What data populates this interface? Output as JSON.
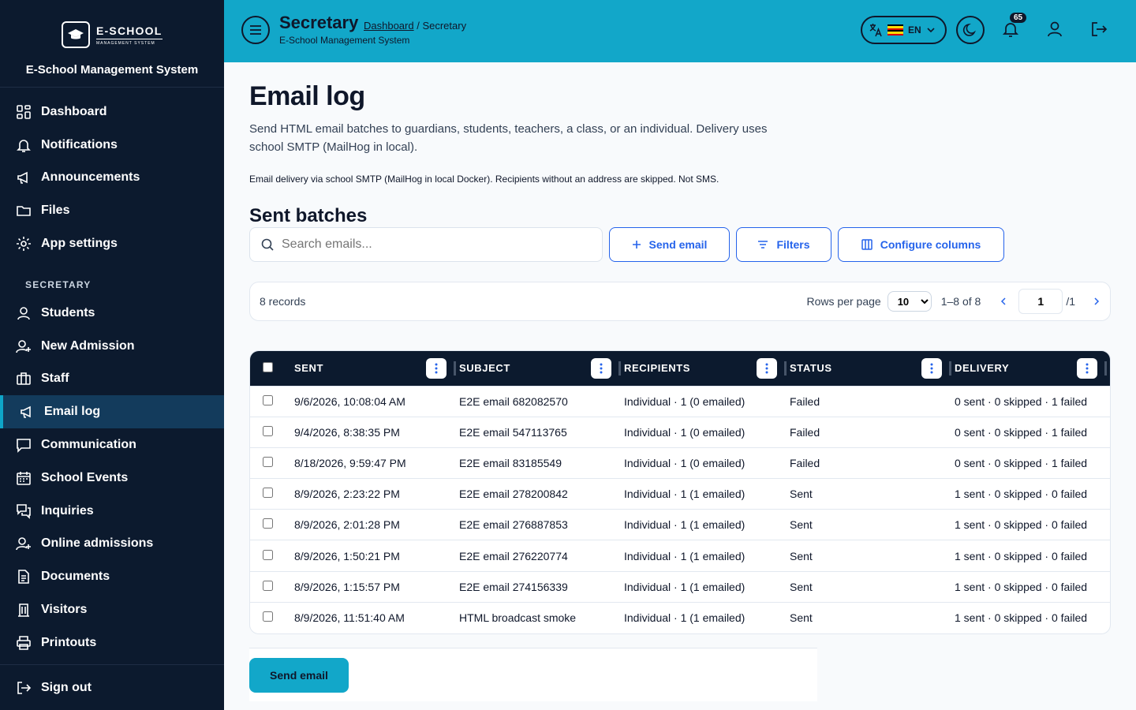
{
  "app": {
    "logo_title": "E-SCHOOL",
    "logo_sub": "MANAGEMENT SYSTEM",
    "name": "E-School Management System"
  },
  "sidebar": {
    "items_top": [
      {
        "label": "Dashboard",
        "icon": "dashboard-icon"
      },
      {
        "label": "Notifications",
        "icon": "bell-icon"
      },
      {
        "label": "Announcements",
        "icon": "megaphone-icon"
      },
      {
        "label": "Files",
        "icon": "folder-icon"
      },
      {
        "label": "App settings",
        "icon": "gear-icon"
      }
    ],
    "section_label": "SECRETARY",
    "items_section": [
      {
        "label": "Students",
        "icon": "user-icon"
      },
      {
        "label": "New Admission",
        "icon": "user-plus-icon"
      },
      {
        "label": "Staff",
        "icon": "briefcase-icon"
      },
      {
        "label": "Email log",
        "icon": "megaphone-icon",
        "active": true
      },
      {
        "label": "Communication",
        "icon": "chat-icon"
      },
      {
        "label": "School Events",
        "icon": "calendar-icon"
      },
      {
        "label": "Inquiries",
        "icon": "chats-icon"
      },
      {
        "label": "Online admissions",
        "icon": "user-plus-icon"
      },
      {
        "label": "Documents",
        "icon": "document-icon"
      },
      {
        "label": "Visitors",
        "icon": "building-icon"
      },
      {
        "label": "Printouts",
        "icon": "printer-icon"
      }
    ],
    "sign_out": "Sign out"
  },
  "header": {
    "title": "Secretary",
    "crumb_link": "Dashboard",
    "crumb_current": " / Secretary",
    "subtitle": "E-School Management System",
    "lang": "EN",
    "notif_count": "65"
  },
  "page": {
    "title": "Email log",
    "description": "Send HTML email batches to guardians, students, teachers, a class, or an individual. Delivery uses school SMTP (MailHog in local).",
    "note": "Email delivery via school SMTP (MailHog in local Docker). Recipients without an address are skipped. Not SMS.",
    "section_title": "Sent batches"
  },
  "toolbar": {
    "search_placeholder": "Search emails...",
    "send_email": "Send email",
    "filters": "Filters",
    "configure_columns": "Configure columns"
  },
  "pager": {
    "records": "8 records",
    "rows_per_page_label": "Rows per page",
    "rows_per_page": "10",
    "range": "1–8 of 8",
    "page": "1",
    "total_pages": "/1"
  },
  "table": {
    "columns": [
      "SENT",
      "SUBJECT",
      "RECIPIENTS",
      "STATUS",
      "DELIVERY"
    ],
    "rows": [
      [
        "9/6/2026, 10:08:04 AM",
        "E2E email 682082570",
        "Individual · 1 (0 emailed)",
        "Failed",
        "0 sent · 0 skipped · 1 failed"
      ],
      [
        "9/4/2026, 8:38:35 PM",
        "E2E email 547113765",
        "Individual · 1 (0 emailed)",
        "Failed",
        "0 sent · 0 skipped · 1 failed"
      ],
      [
        "8/18/2026, 9:59:47 PM",
        "E2E email 83185549",
        "Individual · 1 (0 emailed)",
        "Failed",
        "0 sent · 0 skipped · 1 failed"
      ],
      [
        "8/9/2026, 2:23:22 PM",
        "E2E email 278200842",
        "Individual · 1 (1 emailed)",
        "Sent",
        "1 sent · 0 skipped · 0 failed"
      ],
      [
        "8/9/2026, 2:01:28 PM",
        "E2E email 276887853",
        "Individual · 1 (1 emailed)",
        "Sent",
        "1 sent · 0 skipped · 0 failed"
      ],
      [
        "8/9/2026, 1:50:21 PM",
        "E2E email 276220774",
        "Individual · 1 (1 emailed)",
        "Sent",
        "1 sent · 0 skipped · 0 failed"
      ],
      [
        "8/9/2026, 1:15:57 PM",
        "E2E email 274156339",
        "Individual · 1 (1 emailed)",
        "Sent",
        "1 sent · 0 skipped · 0 failed"
      ],
      [
        "8/9/2026, 11:51:40 AM",
        "HTML broadcast smoke",
        "Individual · 1 (1 emailed)",
        "Sent",
        "1 sent · 0 skipped · 0 failed"
      ]
    ]
  },
  "footer": {
    "send_email": "Send email"
  },
  "colors": {
    "sidebar_bg": "#0c1a2e",
    "header_bg": "#12a7c9",
    "accent": "#2563eb",
    "active_nav": "#133b5c"
  }
}
